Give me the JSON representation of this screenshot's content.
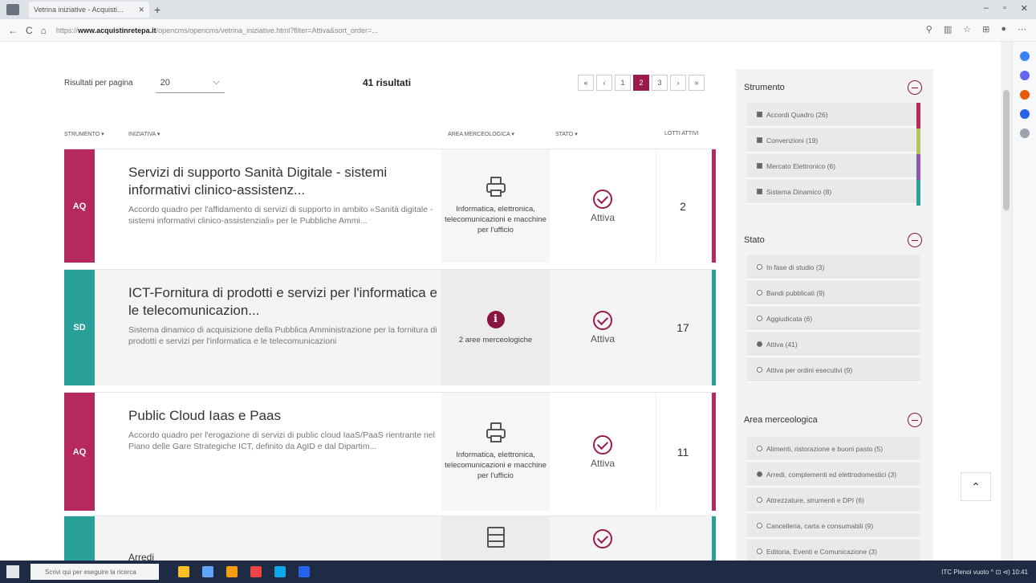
{
  "browser": {
    "tab_title": "Vetrina iniziative - Acquisti...",
    "url_prefix": "https://",
    "url_host": "www.acquistinretepa.it",
    "url_path": "/opencms/opencms/vetrina_iniziative.html?filter=Attiva&sort_order=...",
    "new_tab": "+",
    "back": "←",
    "reload": "C",
    "home": "⌂",
    "win_min": "–",
    "win_max": "▫",
    "win_close": "✕"
  },
  "toolbar": {
    "rpp_label": "Risultati per pagina",
    "rpp_value": "20",
    "rpp_chevron": "⌵",
    "results": "41 risultati",
    "pager": [
      "«",
      "‹",
      "1",
      "2",
      "3",
      "›",
      "»"
    ],
    "pager_active_index": 3
  },
  "headers": {
    "strumento": "Strumento ▾",
    "iniziativa": "Iniziativa ▾",
    "area": "Area merceologica ▾",
    "stato": "Stato ▾",
    "lotti": "Lotti attivi"
  },
  "rows": [
    {
      "badge": "AQ",
      "badge_color": "#b5295f",
      "edge_color": "#b5295f",
      "title": "Servizi di supporto Sanità Digitale - sistemi informativi clinico-assistenz...",
      "desc": "Accordo quadro per l'affidamento di servizi di supporto in ambito «Sanità digitale - sistemi informativi clinico-assistenziali» per le Pubbliche Ammi...",
      "area_icon": "printer-icon",
      "area": "Informatica, elettronica, telecomunicazioni e macchine per l'ufficio",
      "stato": "Attiva",
      "num": "2"
    },
    {
      "badge": "SD",
      "badge_color": "#2aa198",
      "edge_color": "#2aa198",
      "title": "ICT-Fornitura di prodotti e servizi per l'informatica e le telecomunicazion...",
      "desc": "Sistema dinamico di acquisizione della Pubblica Amministrazione per la fornitura di prodotti e servizi per l'informatica e le telecomunicazioni",
      "area_icon": "info-icon",
      "area": "2 aree merceologiche",
      "stato": "Attiva",
      "num": "17"
    },
    {
      "badge": "AQ",
      "badge_color": "#b5295f",
      "edge_color": "#b5295f",
      "title": "Public Cloud Iaas e Paas",
      "desc": "Accordo quadro per l'erogazione di servizi di public cloud IaaS/PaaS rientrante nel Piano delle Gare Strategiche ICT, definito da AgID e dal Dipartim...",
      "area_icon": "printer-icon",
      "area": "Informatica, elettronica, telecomunicazioni e macchine per l'ufficio",
      "stato": "Attiva",
      "num": "11"
    },
    {
      "badge": "",
      "badge_color": "#2aa198",
      "edge_color": "#2aa198",
      "title": "Arredi",
      "desc": "",
      "area_icon": "cabinet-icon",
      "area": "",
      "stato": "",
      "num": ""
    }
  ],
  "filters": {
    "strumento": {
      "title": "Strumento",
      "items": [
        {
          "label": "Accordi Quadro (26)",
          "checked": true,
          "color": "#b5295f"
        },
        {
          "label": "Convenzioni (19)",
          "checked": true,
          "color": "#b5c75a"
        },
        {
          "label": "Mercato Elettronico (6)",
          "checked": true,
          "color": "#8a5aa8"
        },
        {
          "label": "Sistema Dinamico (8)",
          "checked": true,
          "color": "#2aa198"
        }
      ]
    },
    "stato": {
      "title": "Stato",
      "items": [
        {
          "label": "In fase di studio (3)",
          "checked": false
        },
        {
          "label": "Bandi pubblicati (9)",
          "checked": false
        },
        {
          "label": "Aggiudicata (6)",
          "checked": false
        },
        {
          "label": "Attiva (41)",
          "checked": true
        },
        {
          "label": "Attiva per ordini esecutivi (9)",
          "checked": false
        }
      ]
    },
    "area": {
      "title": "Area merceologica",
      "items": [
        {
          "label": "Alimenti, ristorazione e buoni pasto (5)",
          "checked": false
        },
        {
          "label": "Arredi, complementi ed elettrodomestici (3)",
          "checked": true
        },
        {
          "label": "Attrezzature, strumenti e DPI (6)",
          "checked": false
        },
        {
          "label": "Cancelleria, carta e consumabili (9)",
          "checked": false
        },
        {
          "label": "Editoria, Eventi e Comunicazione (3)",
          "checked": false
        }
      ]
    }
  },
  "back_top": "⌃",
  "taskbar": {
    "search": "Scrivi qui per eseguire la ricerca",
    "tray": "ITC Plenoi vuoto   ^  ⊡ ⊲)  10:41"
  }
}
